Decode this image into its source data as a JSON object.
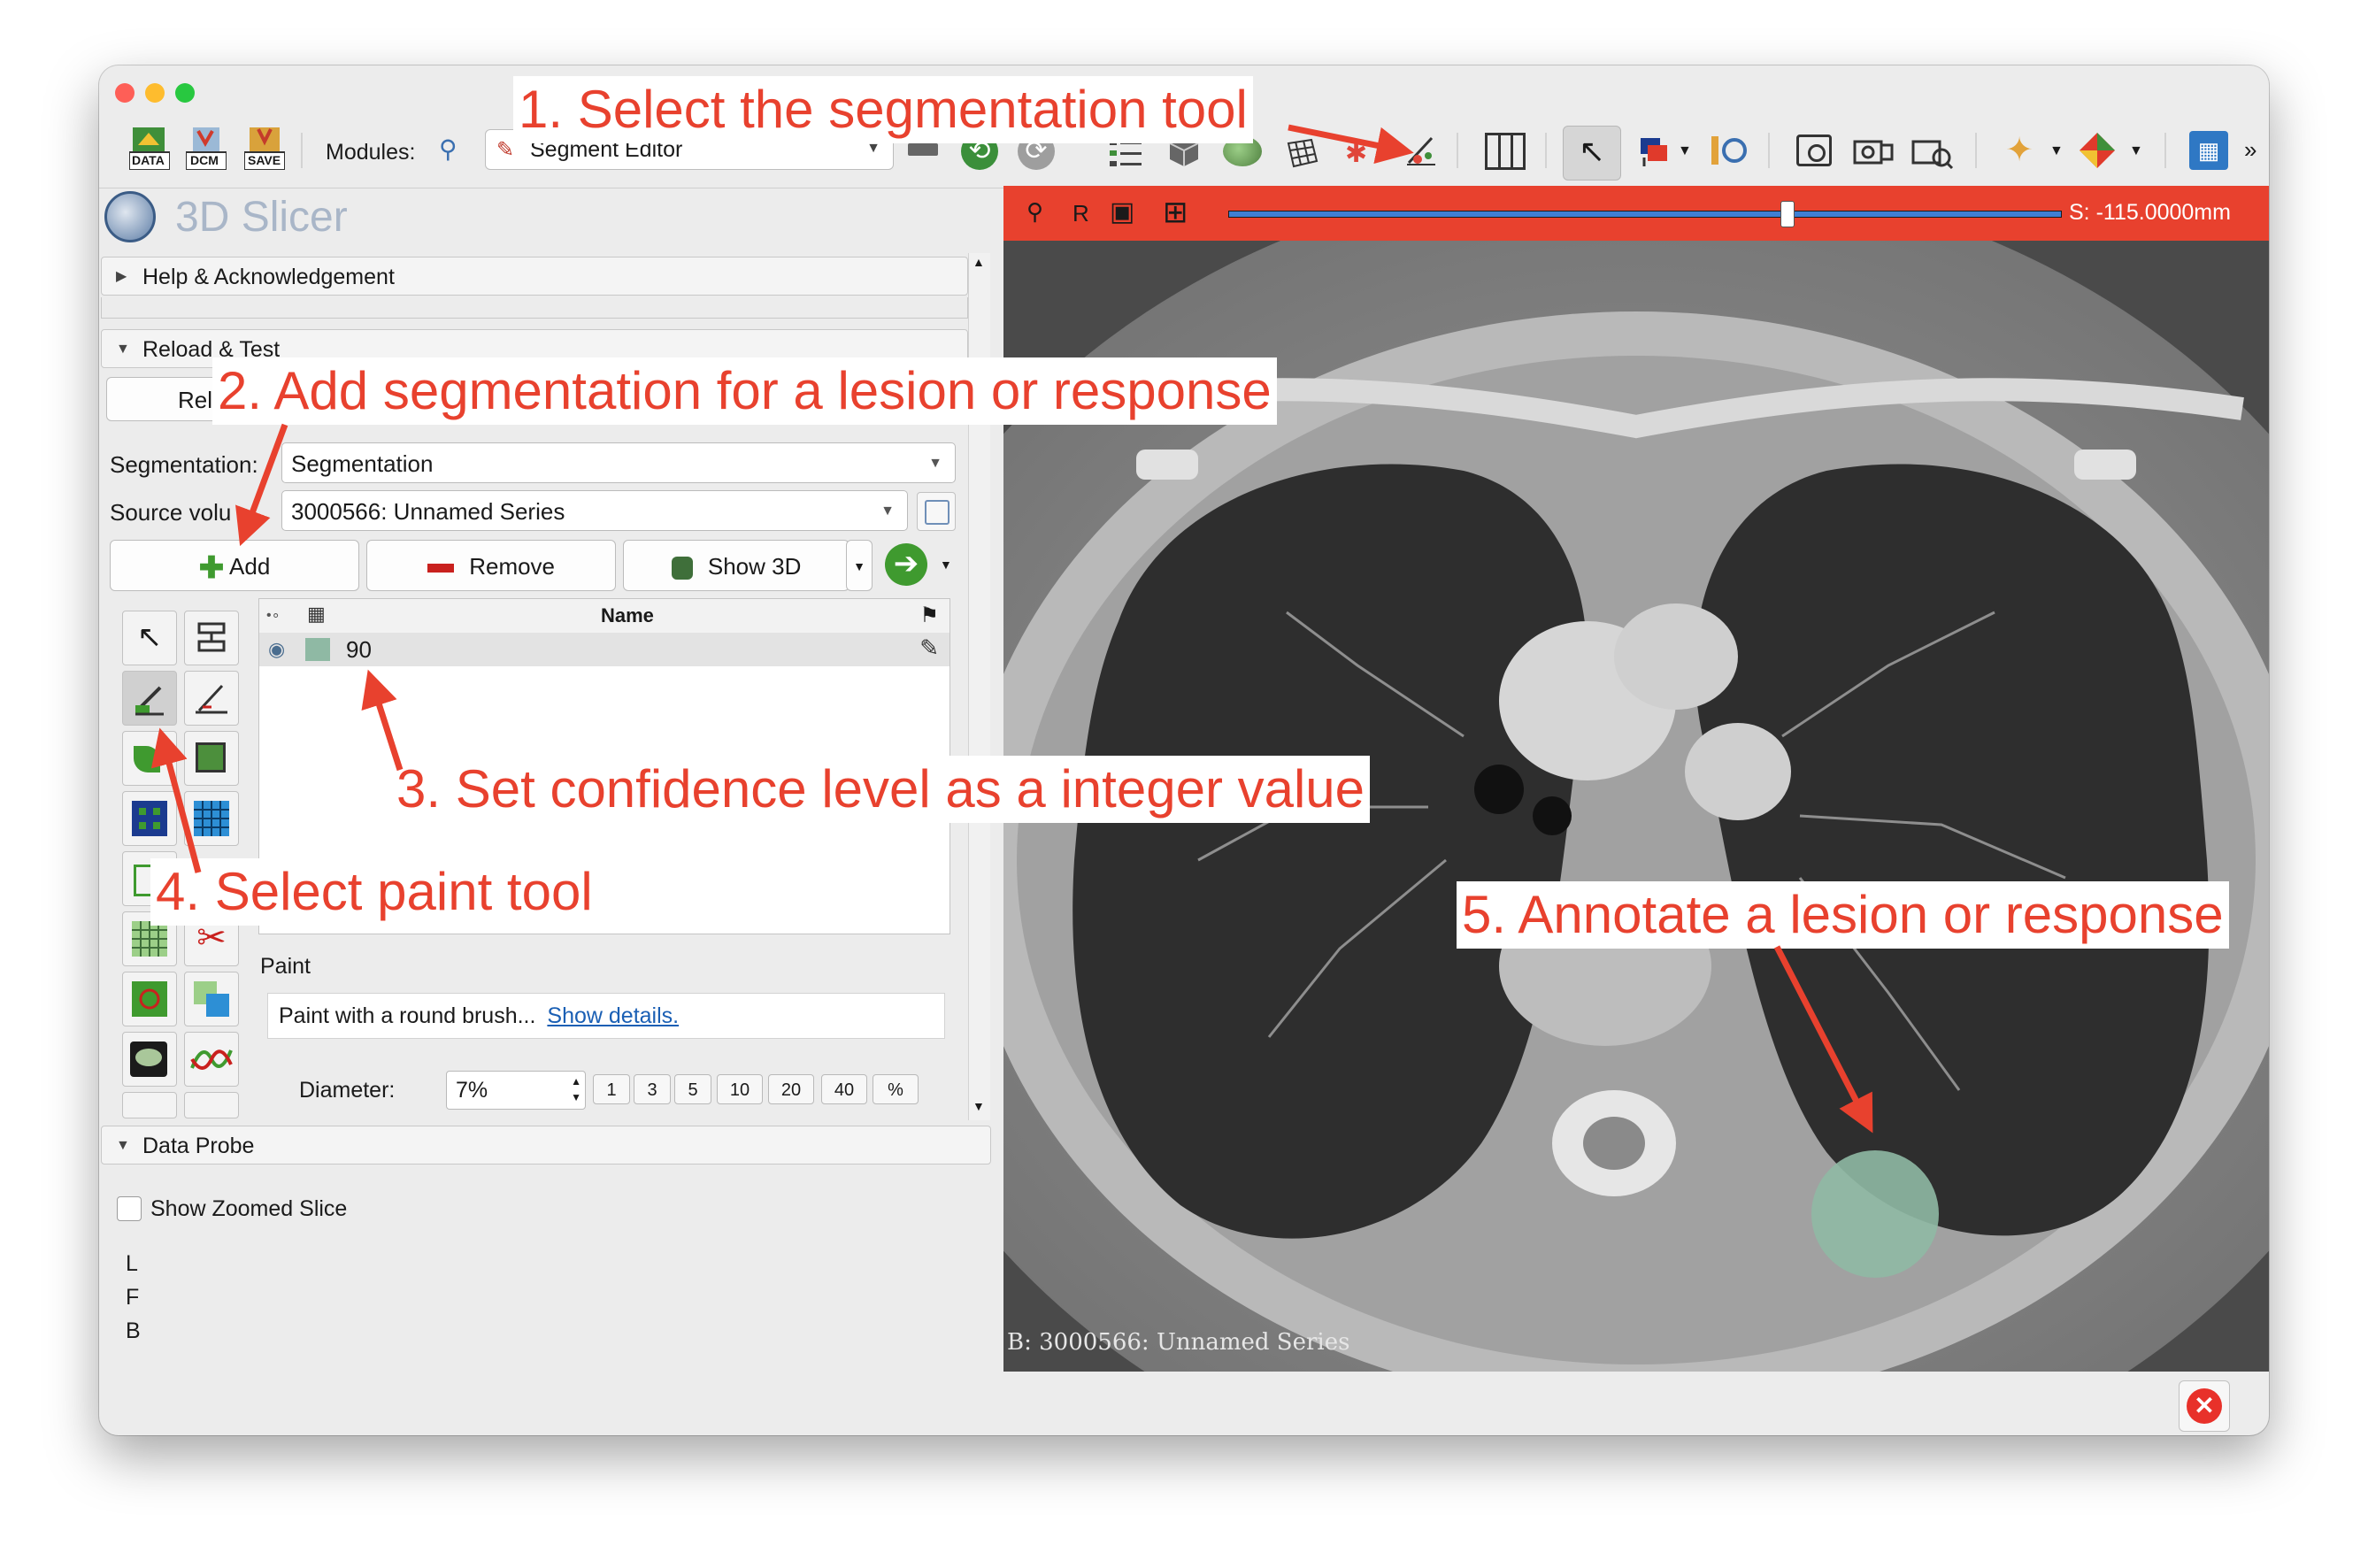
{
  "toolbar": {
    "data_label": "DATA",
    "dcm_label": "DCM",
    "save_label": "SAVE",
    "modules_label": "Modules:",
    "module_selected": "Segment Editor"
  },
  "app": {
    "logo_text": "3D Slicer"
  },
  "sections": {
    "help": "Help & Acknowledgement",
    "reload": "Reload & Test",
    "reload_button": "Relo",
    "data_probe": "Data Probe"
  },
  "segment_editor": {
    "segmentation_label": "Segmentation:",
    "segmentation_value": "Segmentation",
    "source_volume_label": "Source volu",
    "source_volume_value": "3000566: Unnamed Series",
    "add_label": "Add",
    "remove_label": "Remove",
    "show3d_label": "Show 3D",
    "table_header_name": "Name",
    "segment": {
      "name": "90",
      "color": "#8fb9a4"
    },
    "effect_name": "Paint",
    "paint_description": "Paint with a round brush...",
    "show_details": "Show details.",
    "diameter_label": "Diameter:",
    "diameter_value": "7%",
    "diameter_presets": [
      "1",
      "3",
      "5",
      "10",
      "20",
      "40",
      "%"
    ]
  },
  "data_probe": {
    "show_zoomed_slice": "Show Zoomed Slice",
    "lines": [
      "L",
      "F",
      "B"
    ]
  },
  "slice_view": {
    "orientation": "R",
    "offset_text": "S: -115.0000mm",
    "offset_fraction": 0.67,
    "bar_color": "#e8412e",
    "overlay_text": "B: 3000566: Unnamed Series"
  },
  "callouts": {
    "step1": "1. Select the segmentation tool",
    "step2": "2. Add segmentation for a lesion or response",
    "step3": "3. Set confidence level as a integer value",
    "step4": "4. Select paint tool",
    "step5": "5. Annotate a lesion or response"
  },
  "colors": {
    "accent": "#e8412e",
    "link": "#1a5fb4",
    "segment": "#8fb9a4"
  }
}
